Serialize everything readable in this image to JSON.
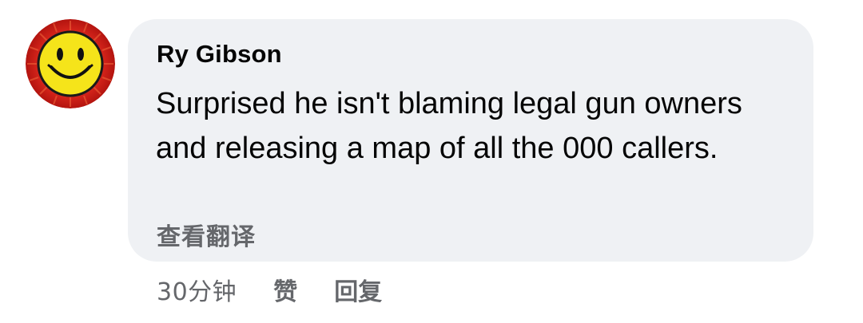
{
  "comment": {
    "author": "Ry Gibson",
    "text": "Surprised he isn't blaming legal gun owners and releasing a map of all the 000 callers.",
    "translate_label": "查看翻译",
    "timestamp": "30分钟",
    "like_label": "赞",
    "reply_label": "回复",
    "avatar_icon": "smiley-face-icon"
  },
  "colors": {
    "bubble_background": "#eff1f4",
    "meta_text": "#65676b",
    "avatar_ring": "#d9261c",
    "avatar_face": "#f5e41a"
  }
}
